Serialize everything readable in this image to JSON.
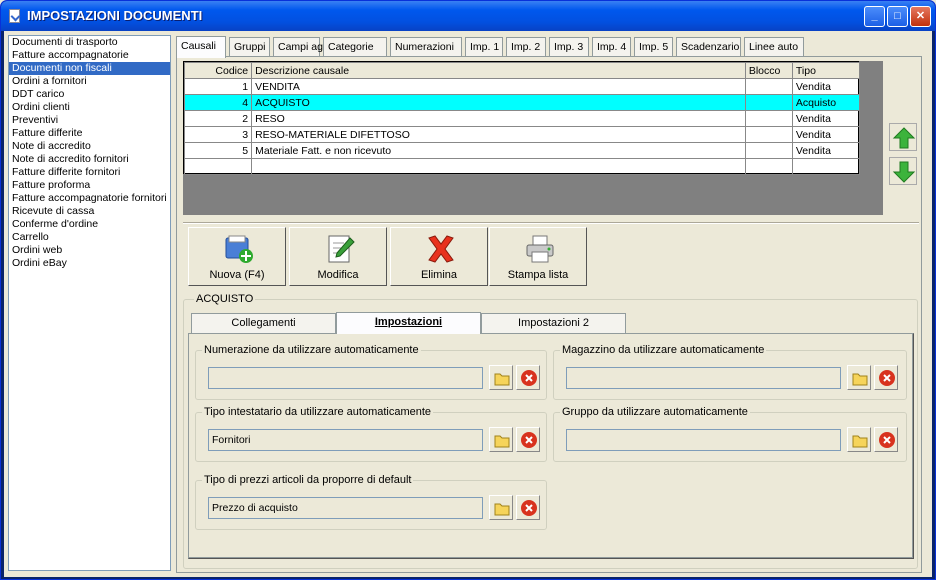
{
  "window": {
    "title": "IMPOSTAZIONI DOCUMENTI",
    "min_label": "_",
    "max_label": "□",
    "close_label": "✕"
  },
  "doc_types": [
    "Documenti di trasporto",
    "Fatture accompagnatorie",
    "Documenti non fiscali",
    "Ordini a fornitori",
    "DDT carico",
    "Ordini clienti",
    "Preventivi",
    "Fatture differite",
    "Note di accredito",
    "Note di accredito fornitori",
    "Fatture differite fornitori",
    "Fatture proforma",
    "Fatture accompagnatorie fornitori",
    "Ricevute di cassa",
    "Conferme d'ordine",
    "Carrello",
    "Ordini web",
    "Ordini eBay"
  ],
  "selected_doc_type_index": 2,
  "tabs": [
    "Causali",
    "Gruppi",
    "Campi agg.",
    "Categorie",
    "Numerazioni",
    "Imp. 1",
    "Imp. 2",
    "Imp. 3",
    "Imp. 4",
    "Imp. 5",
    "Scadenzario",
    "Linee auto"
  ],
  "active_tab_index": 0,
  "grid": {
    "columns": [
      "Codice",
      "Descrizione causale",
      "Blocco",
      "Tipo"
    ],
    "rows": [
      {
        "codice": "1",
        "descrizione": "VENDITA",
        "blocco": "",
        "tipo": "Vendita"
      },
      {
        "codice": "4",
        "descrizione": "ACQUISTO",
        "blocco": "",
        "tipo": "Acquisto"
      },
      {
        "codice": "2",
        "descrizione": "RESO",
        "blocco": "",
        "tipo": "Vendita"
      },
      {
        "codice": "3",
        "descrizione": "RESO-MATERIALE DIFETTOSO",
        "blocco": "",
        "tipo": "Vendita"
      },
      {
        "codice": "5",
        "descrizione": "Materiale Fatt. e non ricevuto",
        "blocco": "",
        "tipo": "Vendita"
      }
    ],
    "highlighted_row_index": 1,
    "highlight_color": "#00ffff"
  },
  "actions": {
    "new_label": "Nuova (F4)",
    "edit_label": "Modifica",
    "delete_label": "Elimina",
    "print_label": "Stampa lista"
  },
  "detail": {
    "group_title": "ACQUISTO",
    "subtabs": [
      "Collegamenti",
      "Impostazioni",
      "Impostazioni 2"
    ],
    "active_subtab_index": 1,
    "fields": {
      "numerazione": {
        "label": "Numerazione da utilizzare automaticamente",
        "value": ""
      },
      "magazzino": {
        "label": "Magazzino da utilizzare automaticamente",
        "value": ""
      },
      "intestatario": {
        "label": "Tipo intestatario da utilizzare automaticamente",
        "value": "Fornitori"
      },
      "gruppo": {
        "label": "Gruppo da utilizzare automaticamente",
        "value": ""
      },
      "prezzi": {
        "label": "Tipo di prezzi articoli da proporre di default",
        "value": "Prezzo di acquisto"
      }
    }
  },
  "icons": {
    "up": "arrow-up-icon",
    "down": "arrow-down-icon",
    "folder": "folder-icon",
    "clear": "clear-icon",
    "new": "new-document-icon",
    "edit": "edit-icon",
    "delete": "delete-icon",
    "print": "printer-icon"
  }
}
